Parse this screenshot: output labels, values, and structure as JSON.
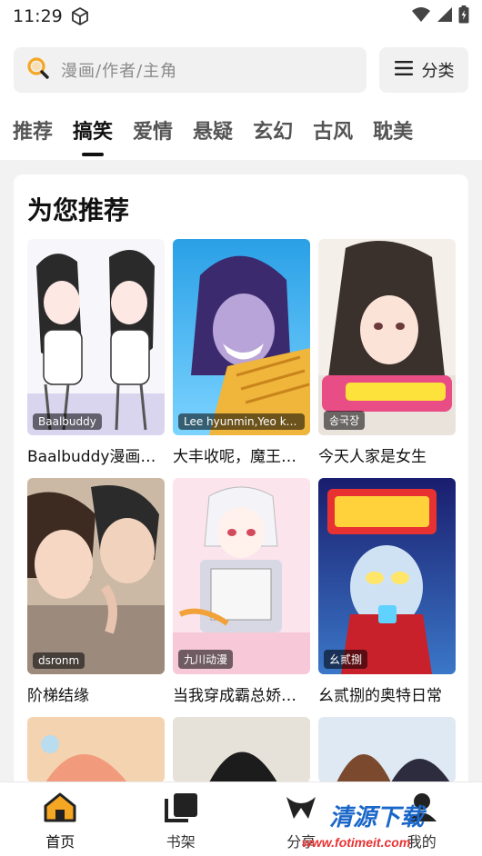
{
  "status_bar": {
    "time": "11:29"
  },
  "search": {
    "placeholder": "漫画/作者/主角"
  },
  "category_button": {
    "label": "分类"
  },
  "tabs": [
    {
      "label": "推荐",
      "active": false
    },
    {
      "label": "搞笑",
      "active": true
    },
    {
      "label": "爱情",
      "active": false
    },
    {
      "label": "悬疑",
      "active": false
    },
    {
      "label": "玄幻",
      "active": false
    },
    {
      "label": "古风",
      "active": false
    },
    {
      "label": "耽美",
      "active": false
    }
  ],
  "section": {
    "title": "为您推荐"
  },
  "items": [
    {
      "title": "Baalbuddy漫画…",
      "author": "Baalbuddy"
    },
    {
      "title": "大丰收呢，魔王…",
      "author": "Lee hyunmin,Yeo kan..."
    },
    {
      "title": "今天人家是女生",
      "author": "송국장"
    },
    {
      "title": "阶梯结缘",
      "author": "dsronm"
    },
    {
      "title": "当我穿成霸总娇…",
      "author": "九川动漫"
    },
    {
      "title": "幺贰捌的奥特日常",
      "author": "幺贰捌"
    }
  ],
  "bottom_nav": [
    {
      "label": "首页",
      "icon": "home-icon",
      "active": true
    },
    {
      "label": "书架",
      "icon": "bookshelf-icon",
      "active": false
    },
    {
      "label": "分享",
      "icon": "share-icon",
      "active": false
    },
    {
      "label": "我的",
      "icon": "profile-icon",
      "active": false
    }
  ],
  "watermark": {
    "brand": "清源下载",
    "url": "www.fotimeit.com"
  },
  "colors": {
    "accent": "#f5a623",
    "tab_active": "#111111",
    "background": "#f2f2f2"
  }
}
